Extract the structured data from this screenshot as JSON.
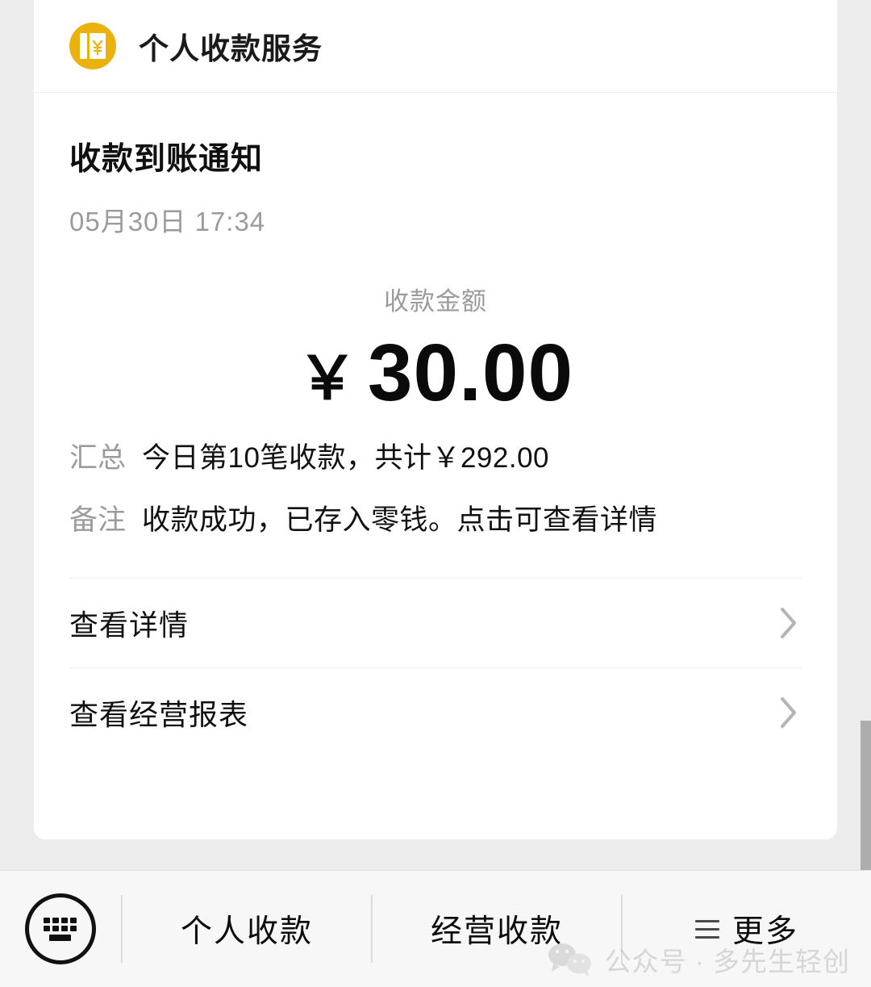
{
  "app": {
    "icon": "ledger-yen-icon",
    "title": "个人收款服务",
    "accent_color": "#ebb10d",
    "page_background": "#ededed",
    "card_background": "#ffffff"
  },
  "notification": {
    "title": "收款到账通知",
    "timestamp": "05月30日 17:34",
    "amount_label": "收款金额",
    "currency_symbol": "￥",
    "amount": "30.00",
    "rows": [
      {
        "key": "汇总",
        "value": "今日第10笔收款，共计￥292.00"
      },
      {
        "key": "备注",
        "value": "收款成功，已存入零钱。点击可查看详情"
      }
    ]
  },
  "actions": [
    {
      "label": "查看详情",
      "icon": "chevron-right-icon"
    },
    {
      "label": "查看经营报表",
      "icon": "chevron-right-icon"
    }
  ],
  "bottom_bar": {
    "keyboard_icon": "keyboard-icon",
    "items": [
      {
        "label": "个人收款",
        "icon": ""
      },
      {
        "label": "经营收款",
        "icon": ""
      },
      {
        "label": "更多",
        "icon": "hamburger-icon"
      }
    ]
  },
  "watermark": {
    "logo": "wechat-logo",
    "text": "公众号 · 多先生轻创"
  }
}
